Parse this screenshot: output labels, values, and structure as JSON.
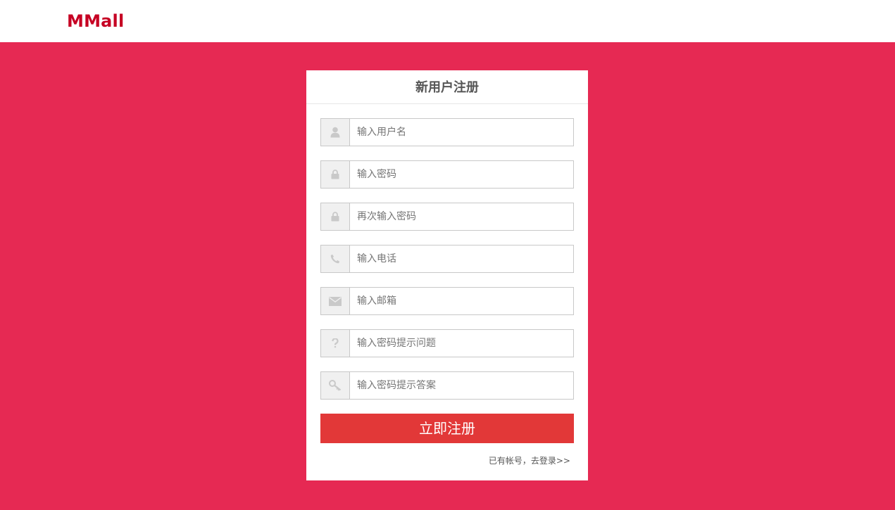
{
  "header": {
    "logo": "MMall"
  },
  "register": {
    "title": "新用户注册",
    "fields": [
      {
        "icon": "user-icon",
        "placeholder": "输入用户名"
      },
      {
        "icon": "lock-icon",
        "placeholder": "输入密码"
      },
      {
        "icon": "lock-icon",
        "placeholder": "再次输入密码"
      },
      {
        "icon": "phone-icon",
        "placeholder": "输入电话"
      },
      {
        "icon": "envelope-icon",
        "placeholder": "输入邮箱"
      },
      {
        "icon": "question-icon",
        "placeholder": "输入密码提示问题"
      },
      {
        "icon": "key-icon",
        "placeholder": "输入密码提示答案"
      }
    ],
    "submit_label": "立即注册",
    "login_link": "已有帐号，去登录>>"
  },
  "colors": {
    "background": "#e62953",
    "logo": "#c60023",
    "submit": "#e23838",
    "icon": "#c9c9c9"
  }
}
